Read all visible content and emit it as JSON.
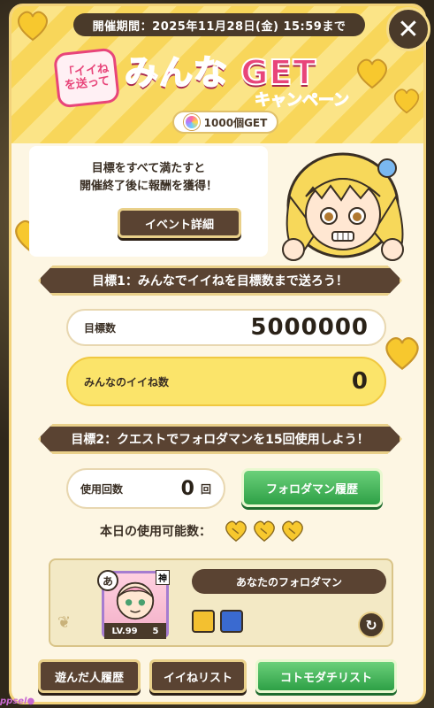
{
  "period": "開催期間：2025年11月28日(金) 15:59まで",
  "title": {
    "quote_part": "「イイね を送って",
    "main": "みんな GET",
    "sub": "キャンペーン"
  },
  "reward": "1000個GET",
  "goal_text_line1": "目標をすべて満たすと",
  "goal_text_line2": "開催終了後に報酬を獲得！",
  "event_detail_button": "イベント詳細",
  "objective1": "目標1：みんなでイイねを目標数まで送ろう！",
  "target_label": "目標数",
  "target_value": "5000000",
  "everyone_label": "みんなのイイね数",
  "everyone_value": "0",
  "objective2": "目標2：クエストでフォロダマンを15回使用しよう！",
  "usage_label": "使用回数",
  "usage_value": "0",
  "usage_unit": "回",
  "history_button": "フォロダマン履歴",
  "available_today_label": "本日の使用可能数：",
  "available_count": 3,
  "monster_section_title": "あなたのフォロダマン",
  "monster": {
    "type_char": "あ",
    "rank": "神",
    "level": "LV.99",
    "luck": "5"
  },
  "bottom_buttons": {
    "played": "遊んだ人履歴",
    "iine_list": "イイねリスト",
    "kotomo": "コトモダチリスト"
  },
  "watermark": "ppsel●",
  "colors": {
    "accent_pink": "#e8457a",
    "brown": "#5a4332",
    "gold": "#f8d65a",
    "green": "#2ea046"
  }
}
